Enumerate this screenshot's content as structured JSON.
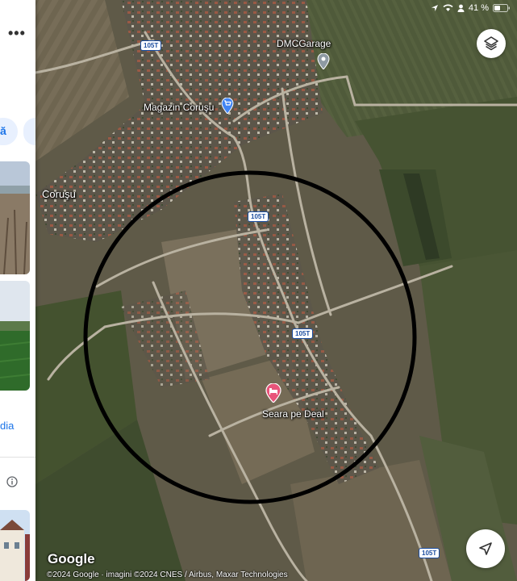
{
  "status_bar": {
    "battery_text": "41 %",
    "icons": [
      "location-arrow-icon",
      "wifi-icon",
      "person-icon",
      "battery-icon"
    ]
  },
  "side_panel": {
    "more_icon": "more-horizontal-icon",
    "chip_fragment_text": "ă",
    "media_link_fragment": "dia",
    "info_icon": "info-icon"
  },
  "map": {
    "place_labels": {
      "dmc_garage": "DMCGarage",
      "magazin_corusu": "Magazin Coruşu",
      "corusu": "Coruşu",
      "seara_pe_deal": "Seara pe Deal"
    },
    "route_shield": "105T",
    "circle_annotation_color": "#000000",
    "pin_colors": {
      "garage": "#8e9aa3",
      "shop": "#4285f4",
      "hotel": "#e8547a"
    }
  },
  "controls": {
    "layers_icon": "layers-icon",
    "location_icon": "navigation-arrow-icon"
  },
  "footer": {
    "google_logo": "Google",
    "attribution": "©2024 Google · imagini ©2024 CNES / Airbus, Maxar Technologies"
  }
}
